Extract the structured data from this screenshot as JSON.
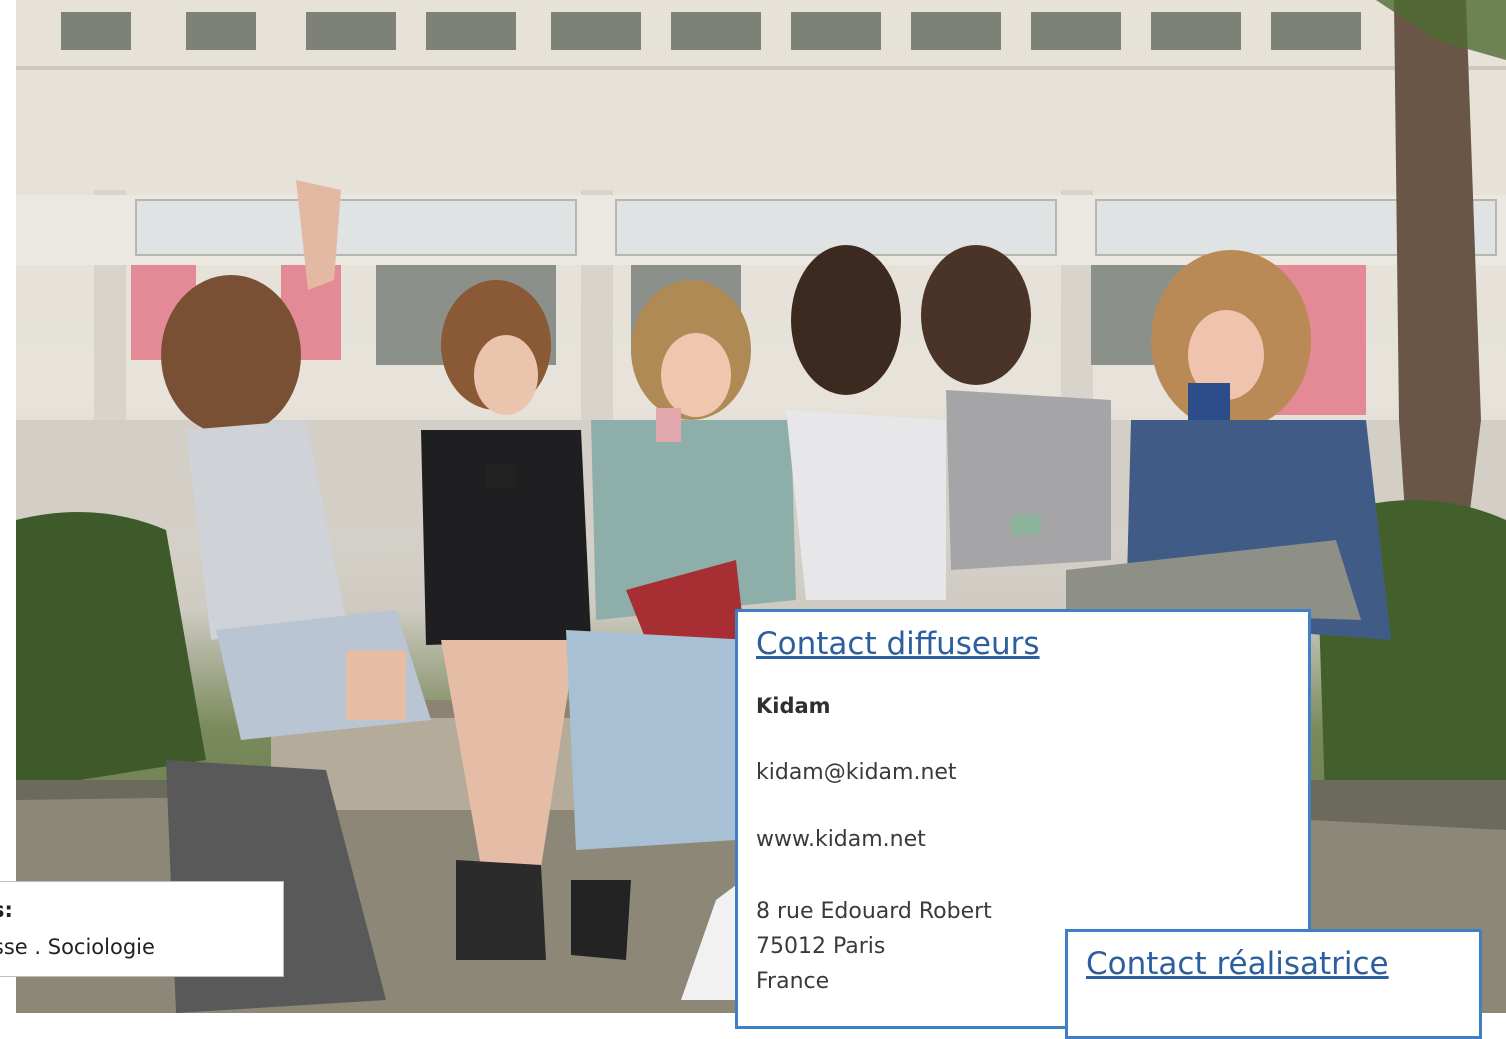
{
  "contact_diffuseurs": {
    "title": "Contact diffuseurs",
    "company": "Kidam",
    "email": "kidam@kidam.net",
    "website": "www.kidam.net",
    "address_line1": "8 rue Edouard Robert",
    "address_line2": "75012 Paris",
    "address_line3": "France"
  },
  "contact_realisatrice": {
    "title": "Contact réalisatrice"
  },
  "themes": {
    "label": "s:",
    "text": "esse . Sociologie"
  },
  "colors": {
    "accent_border": "#3f7fc3",
    "link_title": "#2c5f9e"
  }
}
